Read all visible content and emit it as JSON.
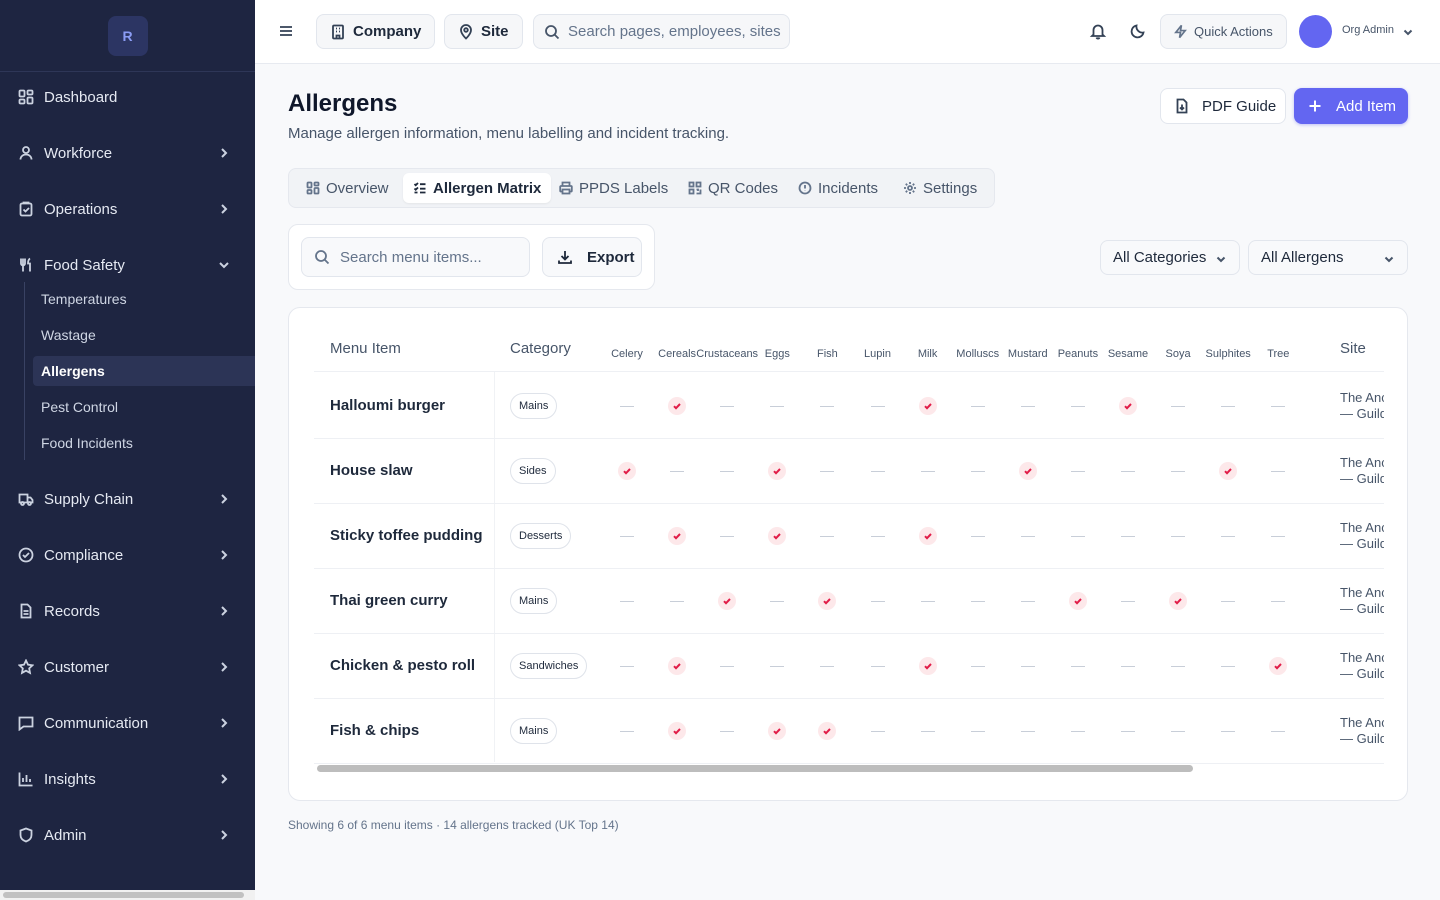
{
  "sidebar": {
    "logo_letter": "R",
    "items": [
      {
        "label": "Dashboard"
      },
      {
        "label": "Workforce"
      },
      {
        "label": "Operations"
      },
      {
        "label": "Food Safety"
      },
      {
        "label": "Supply Chain"
      },
      {
        "label": "Compliance"
      },
      {
        "label": "Records"
      },
      {
        "label": "Customer"
      },
      {
        "label": "Communication"
      },
      {
        "label": "Insights"
      },
      {
        "label": "Admin"
      }
    ],
    "food_safety_subitems": [
      {
        "label": "Temperatures"
      },
      {
        "label": "Wastage"
      },
      {
        "label": "Allergens"
      },
      {
        "label": "Pest Control"
      },
      {
        "label": "Food Incidents"
      }
    ]
  },
  "topbar": {
    "company_label": "Company",
    "site_label": "Site",
    "search_placeholder": "Search pages, employees, sites",
    "quick_actions_label": "Quick Actions",
    "user_name": "Org Admin"
  },
  "page": {
    "title": "Allergens",
    "subtitle": "Manage allergen information, menu labelling and incident tracking.",
    "pdf_button": "PDF Guide",
    "add_button": "Add Item"
  },
  "tabs": [
    {
      "label": "Overview"
    },
    {
      "label": "Allergen Matrix"
    },
    {
      "label": "PPDS Labels"
    },
    {
      "label": "QR Codes"
    },
    {
      "label": "Incidents"
    },
    {
      "label": "Settings"
    }
  ],
  "toolbar": {
    "search_placeholder": "Search menu items...",
    "export_label": "Export",
    "category_filter": "All Categories",
    "allergen_filter": "All Allergens"
  },
  "table": {
    "headers": {
      "item": "Menu Item",
      "category": "Category",
      "site": "Site"
    },
    "allergens": [
      "Celery",
      "Cereals",
      "Crustaceans",
      "Eggs",
      "Fish",
      "Lupin",
      "Milk",
      "Molluscs",
      "Mustard",
      "Peanuts",
      "Sesame",
      "Soya",
      "Sulphites",
      "Tree"
    ],
    "rows": [
      {
        "name": "Halloumi burger",
        "category": "Mains",
        "site_line1": "The Anc",
        "site_line2": "— Guild",
        "flags": [
          0,
          1,
          0,
          0,
          0,
          0,
          1,
          0,
          0,
          0,
          1,
          0,
          0,
          0
        ]
      },
      {
        "name": "House slaw",
        "category": "Sides",
        "site_line1": "The Anc",
        "site_line2": "— Guild",
        "flags": [
          1,
          0,
          0,
          1,
          0,
          0,
          0,
          0,
          1,
          0,
          0,
          0,
          1,
          0
        ]
      },
      {
        "name": "Sticky toffee pudding",
        "category": "Desserts",
        "site_line1": "The Anc",
        "site_line2": "— Guild",
        "flags": [
          0,
          1,
          0,
          1,
          0,
          0,
          1,
          0,
          0,
          0,
          0,
          0,
          0,
          0
        ]
      },
      {
        "name": "Thai green curry",
        "category": "Mains",
        "site_line1": "The Anc",
        "site_line2": "— Guild",
        "flags": [
          0,
          0,
          1,
          0,
          1,
          0,
          0,
          0,
          0,
          1,
          0,
          1,
          0,
          0
        ]
      },
      {
        "name": "Chicken & pesto roll",
        "category": "Sandwiches",
        "site_line1": "The Anc",
        "site_line2": "— Guild",
        "flags": [
          0,
          1,
          0,
          0,
          0,
          0,
          1,
          0,
          0,
          0,
          0,
          0,
          0,
          1
        ]
      },
      {
        "name": "Fish & chips",
        "category": "Mains",
        "site_line1": "The Anc",
        "site_line2": "— Guild",
        "flags": [
          0,
          1,
          0,
          1,
          1,
          0,
          0,
          0,
          0,
          0,
          0,
          0,
          0,
          0
        ]
      }
    ]
  },
  "footer_note": "Showing 6 of 6 menu items · 14 allergens tracked (UK Top 14)",
  "colors": {
    "sidebar_bg": "#1e2541",
    "accent": "#6366f1",
    "allergen_mark": "#e11d48"
  }
}
